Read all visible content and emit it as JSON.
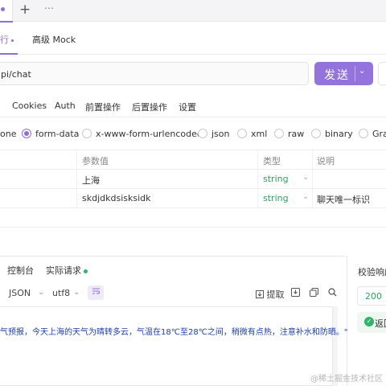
{
  "tab_strip": {
    "add_glyph": "+",
    "more_glyph": "⋯"
  },
  "modes": {
    "run": "行",
    "mock": "高级 Mock"
  },
  "url": {
    "value": "pi/chat"
  },
  "send": {
    "label": "发送",
    "caret": "⌄"
  },
  "subtabs": [
    "Cookies",
    "Auth",
    "前置操作",
    "后置操作",
    "设置"
  ],
  "body_types": {
    "none": "one",
    "form_data": "form-data",
    "urlencoded": "x-www-form-urlencoded",
    "json": "json",
    "xml": "xml",
    "raw": "raw",
    "binary": "binary",
    "graphql": "Gra",
    "selected": "form-data"
  },
  "params": {
    "headers": {
      "value": "参数值",
      "type": "类型",
      "desc": "说明"
    },
    "rows": [
      {
        "value": "上海",
        "type": "string",
        "desc": ""
      },
      {
        "value": "skdjdkdsisksidk",
        "type": "string",
        "desc": "聊天唯一标识"
      }
    ]
  },
  "response": {
    "tabs": {
      "console": "控制台",
      "actual": "实际请求"
    },
    "format": "JSON",
    "encoding": "utf8",
    "extract_label": "提取",
    "body_line": "\"天气预报，今天上海的天气为晴转多云，气温在18℃至28℃之间，稍微有点热，注意补水和防晒。\"",
    "body_visible": "气预报，今天上海的天气为晴转多云，气温在18℃至28℃之间，稍微有点热，注意补水和防晒。\""
  },
  "validation": {
    "title": "校验响应",
    "status_code": "200",
    "return_label": "返回"
  },
  "watermark": "@稀土掘金技术社区",
  "colors": {
    "accent": "#8e6ed1",
    "send_bg": "#9473dc",
    "success": "#31b36b",
    "string_type": "#2f9f63",
    "code": "#1d3ea8"
  }
}
